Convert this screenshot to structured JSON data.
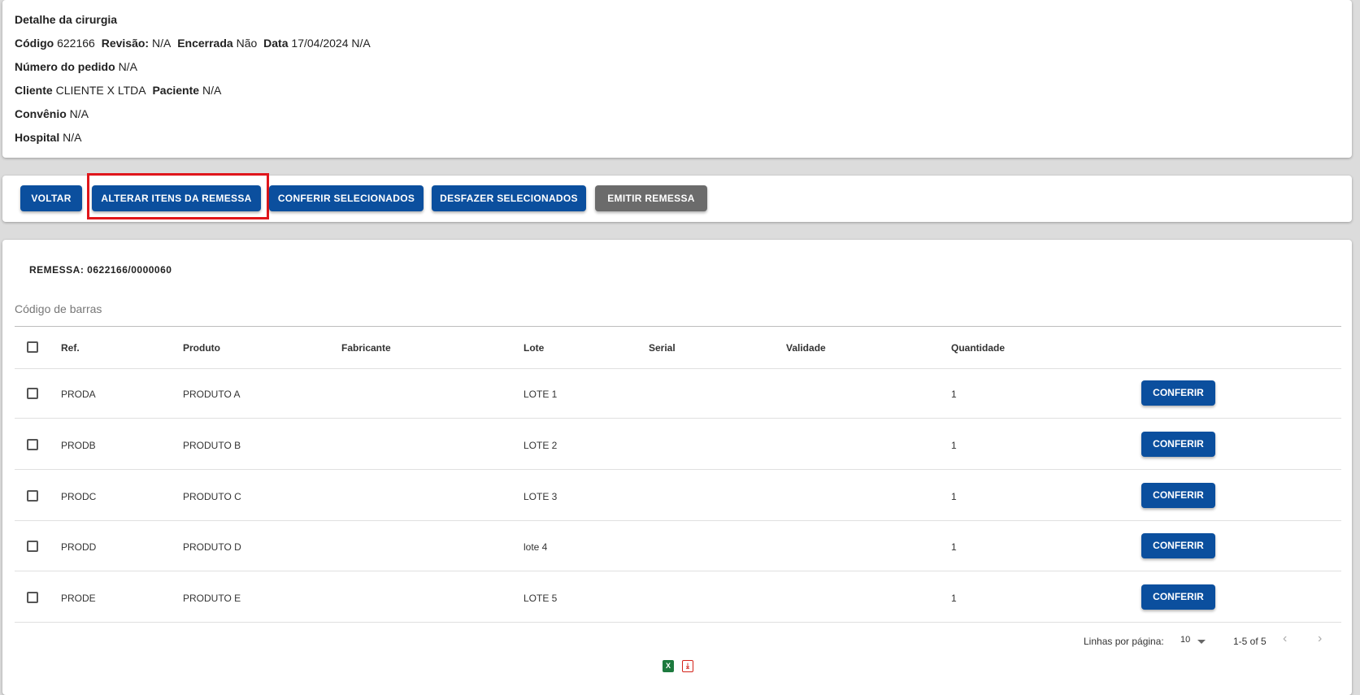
{
  "detail": {
    "title": "Detalhe da cirurgia",
    "codigo_label": "Código",
    "codigo_value": "622166",
    "revisao_label": "Revisão:",
    "revisao_value": "N/A",
    "encerrada_label": "Encerrada",
    "encerrada_value": "Não",
    "data_label": "Data",
    "data_value": "17/04/2024 N/A",
    "pedido_label": "Número do pedido",
    "pedido_value": "N/A",
    "cliente_label": "Cliente",
    "cliente_value": "CLIENTE X LTDA",
    "paciente_label": "Paciente",
    "paciente_value": "N/A",
    "convenio_label": "Convênio",
    "convenio_value": "N/A",
    "hospital_label": "Hospital",
    "hospital_value": "N/A"
  },
  "actions": {
    "voltar": "VOLTAR",
    "alterar": "ALTERAR ITENS DA REMESSA",
    "conferir_sel": "CONFERIR SELECIONADOS",
    "desfazer_sel": "DESFAZER SELECIONADOS",
    "emitir": "EMITIR REMESSA"
  },
  "remessa": {
    "label": "REMESSA: 0622166/0000060",
    "barcode_placeholder": "Código de barras"
  },
  "table": {
    "headers": {
      "ref": "Ref.",
      "produto": "Produto",
      "fabricante": "Fabricante",
      "lote": "Lote",
      "serial": "Serial",
      "validade": "Validade",
      "quantidade": "Quantidade"
    },
    "rows": [
      {
        "ref": "PRODA",
        "produto": "PRODUTO A",
        "fabricante": "",
        "lote": "LOTE 1",
        "serial": "",
        "validade": "",
        "quantidade": "1",
        "action": "CONFERIR"
      },
      {
        "ref": "PRODB",
        "produto": "PRODUTO B",
        "fabricante": "",
        "lote": "LOTE 2",
        "serial": "",
        "validade": "",
        "quantidade": "1",
        "action": "CONFERIR"
      },
      {
        "ref": "PRODC",
        "produto": "PRODUTO C",
        "fabricante": "",
        "lote": "LOTE 3",
        "serial": "",
        "validade": "",
        "quantidade": "1",
        "action": "CONFERIR"
      },
      {
        "ref": "PRODD",
        "produto": "PRODUTO D",
        "fabricante": "",
        "lote": "lote 4",
        "serial": "",
        "validade": "",
        "quantidade": "1",
        "action": "CONFERIR"
      },
      {
        "ref": "PRODE",
        "produto": "PRODUTO E",
        "fabricante": "",
        "lote": "LOTE 5",
        "serial": "",
        "validade": "",
        "quantidade": "1",
        "action": "CONFERIR"
      }
    ]
  },
  "pagination": {
    "rows_label": "Linhas por página:",
    "rows_value": "10",
    "range": "1-5 of 5",
    "prev_icon": "chevron-left-icon",
    "next_icon": "chevron-right-icon"
  },
  "export": {
    "excel_icon": "excel-icon",
    "pdf_icon": "pdf-icon",
    "excel_glyph": "X",
    "pdf_glyph": "⤓"
  },
  "colors": {
    "primary": "#0b4f9e",
    "disabled": "#6b6b6b",
    "highlight": "#e0161b",
    "excel": "#1d7a3e",
    "pdf": "#d4231a"
  }
}
